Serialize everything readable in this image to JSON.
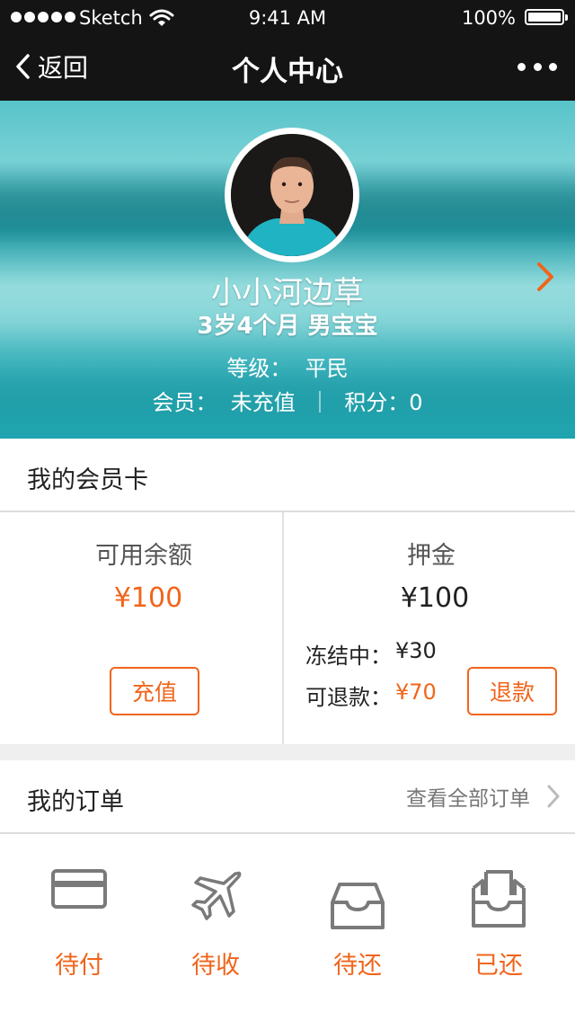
{
  "status_bar": {
    "carrier": "Sketch",
    "time": "9:41 AM",
    "battery": "100%"
  },
  "nav": {
    "back_label": "返回",
    "title": "个人中心"
  },
  "profile": {
    "name": "小小河边草",
    "age": "3岁4个月 男宝宝",
    "level": "等级：  平民",
    "membership": "会员：  未充值  ｜  积分：0"
  },
  "member_card": {
    "title": "我的会员卡",
    "balance": {
      "label": "可用余额",
      "amount": "¥100",
      "button": "充值"
    },
    "deposit": {
      "label": "押金",
      "amount": "¥100",
      "frozen_label": "冻结中：",
      "frozen_value": "¥30",
      "refundable_label": "可退款：",
      "refundable_value": "¥70",
      "button": "退款"
    }
  },
  "orders": {
    "title": "我的订单",
    "view_all": "查看全部订单",
    "items": [
      {
        "label": "待付",
        "icon": "card-icon"
      },
      {
        "label": "待收",
        "icon": "airplane-icon"
      },
      {
        "label": "待还",
        "icon": "inbox-icon"
      },
      {
        "label": "已还",
        "icon": "box-returned-icon"
      }
    ]
  },
  "colors": {
    "accent": "#f0651b",
    "topbar": "#141414",
    "header_teal": "#2aa3ad"
  }
}
